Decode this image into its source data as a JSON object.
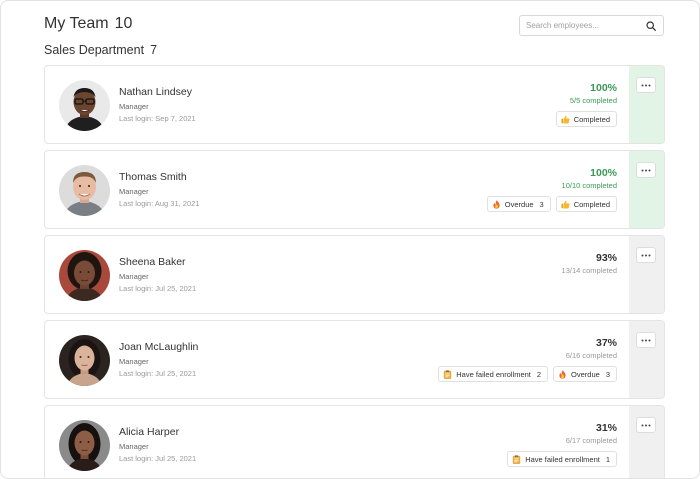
{
  "header": {
    "title": "My Team",
    "count": "10"
  },
  "search": {
    "placeholder": "Search employees..."
  },
  "department": {
    "title": "Sales Department",
    "count": "7"
  },
  "colors": {
    "complete_green": "#3a9a55",
    "complete_bg": "#e2f4e6",
    "side_bg": "#f0f0f0"
  },
  "employees": [
    {
      "name": "Nathan Lindsey",
      "role": "Manager",
      "last_login": "Last login: Sep 7, 2021",
      "percent": "100%",
      "completed": "5/5 completed",
      "complete": true,
      "badges": [
        {
          "icon": "thumbs-up-icon",
          "label": "Completed",
          "count": ""
        }
      ]
    },
    {
      "name": "Thomas Smith",
      "role": "Manager",
      "last_login": "Last login: Aug 31, 2021",
      "percent": "100%",
      "completed": "10/10 completed",
      "complete": true,
      "badges": [
        {
          "icon": "fire-icon",
          "label": "Overdue",
          "count": "3"
        },
        {
          "icon": "thumbs-up-icon",
          "label": "Completed",
          "count": ""
        }
      ]
    },
    {
      "name": "Sheena Baker",
      "role": "Manager",
      "last_login": "Last login: Jul 25, 2021",
      "percent": "93%",
      "completed": "13/14 completed",
      "complete": false,
      "badges": []
    },
    {
      "name": "Joan McLaughlin",
      "role": "Manager",
      "last_login": "Last login: Jul 25, 2021",
      "percent": "37%",
      "completed": "6/16 completed",
      "complete": false,
      "badges": [
        {
          "icon": "clipboard-icon",
          "label": "Have failed enrollment",
          "count": "2"
        },
        {
          "icon": "fire-icon",
          "label": "Overdue",
          "count": "3"
        }
      ]
    },
    {
      "name": "Alicia Harper",
      "role": "Manager",
      "last_login": "Last login: Jul 25, 2021",
      "percent": "31%",
      "completed": "6/17 completed",
      "complete": false,
      "badges": [
        {
          "icon": "clipboard-icon",
          "label": "Have failed enrollment",
          "count": "1"
        }
      ]
    }
  ]
}
